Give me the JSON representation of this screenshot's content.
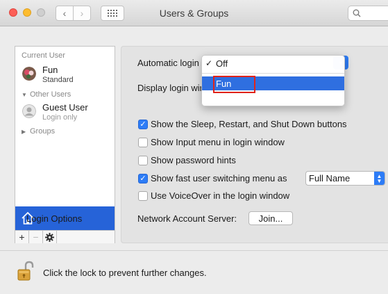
{
  "window": {
    "title": "Users & Groups"
  },
  "toolbar": {
    "back_icon": "chevron-left-icon",
    "forward_icon": "chevron-right-icon",
    "grid_icon": "grid-icon",
    "search_icon": "search-icon"
  },
  "sidebar": {
    "current_user_header": "Current User",
    "current_user": {
      "name": "Fun",
      "role": "Standard"
    },
    "other_users_header": "Other Users",
    "guest": {
      "name": "Guest User",
      "sub": "Login only"
    },
    "groups_label": "Groups",
    "login_options": "Login Options",
    "tools": {
      "add": "+",
      "remove": "−"
    }
  },
  "options": {
    "automatic_login_label": "Automatic login",
    "display_login_label": "Display login window as:",
    "checkboxes": [
      {
        "label": "Show the Sleep, Restart, and Shut Down buttons",
        "checked": true
      },
      {
        "label": "Show Input menu in login window",
        "checked": false
      },
      {
        "label": "Show password hints",
        "checked": false
      },
      {
        "label": "Show fast user switching menu as",
        "checked": true
      },
      {
        "label": "Use VoiceOver in the login window",
        "checked": false
      }
    ],
    "fast_switch_value": "Full Name",
    "network_server_label": "Network Account Server:",
    "join_label": "Join..."
  },
  "menu": {
    "items": [
      {
        "label": "Off",
        "checked": true
      },
      {
        "label": "Fun",
        "selected": true
      }
    ]
  },
  "footer": {
    "lock_text": "Click the lock to prevent further changes."
  },
  "colors": {
    "accent": "#2d7cf6",
    "selection": "#2663d8",
    "highlight_box": "#e2231a"
  }
}
